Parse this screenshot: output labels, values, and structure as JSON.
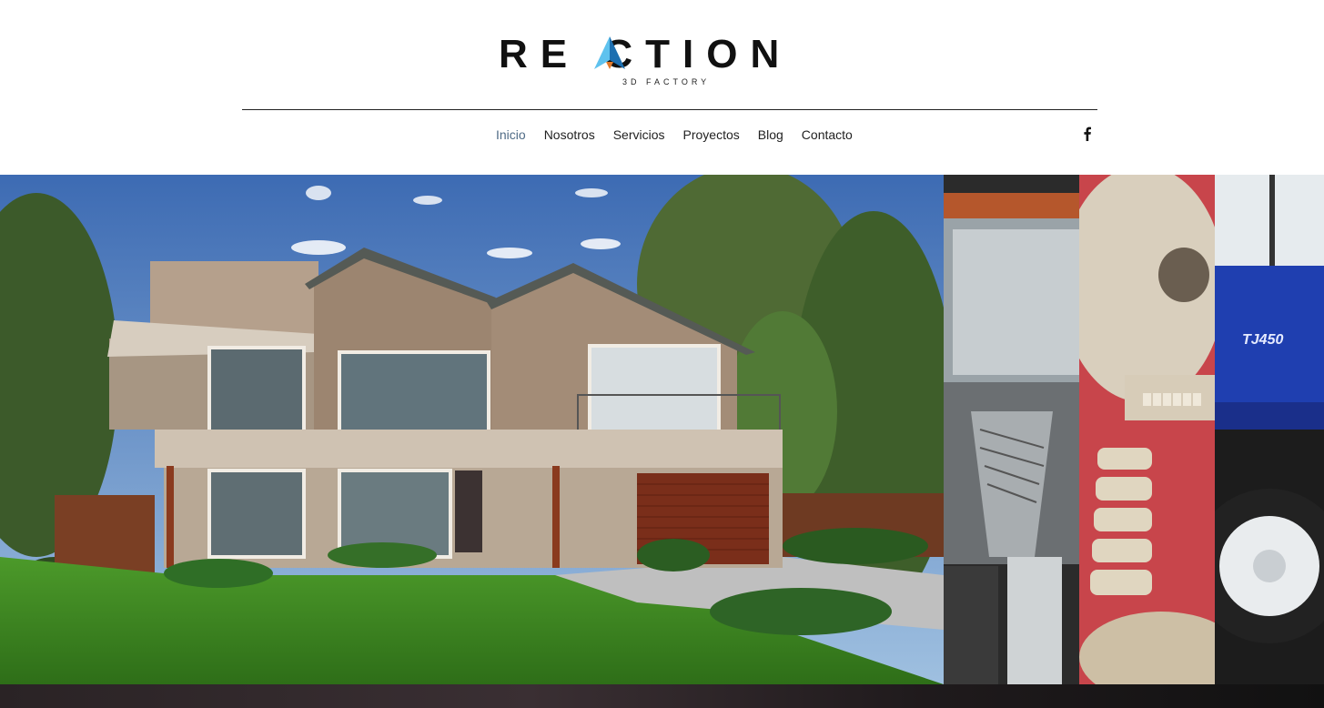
{
  "brand": {
    "name": "RE CTION",
    "tagline": "3D FACTORY",
    "accent": "#3aa4d8"
  },
  "nav": {
    "items": [
      {
        "label": "Inicio",
        "active": true
      },
      {
        "label": "Nosotros",
        "active": false
      },
      {
        "label": "Servicios",
        "active": false
      },
      {
        "label": "Proyectos",
        "active": false
      },
      {
        "label": "Blog",
        "active": false
      },
      {
        "label": "Contacto",
        "active": false
      }
    ],
    "active_color": "#4f6b86"
  },
  "social": {
    "icon": "facebook-icon"
  },
  "hero": {
    "panels": [
      "house-render",
      "gear-render",
      "skull-render",
      "tractor-render"
    ],
    "tractor_label": "TJ450"
  }
}
